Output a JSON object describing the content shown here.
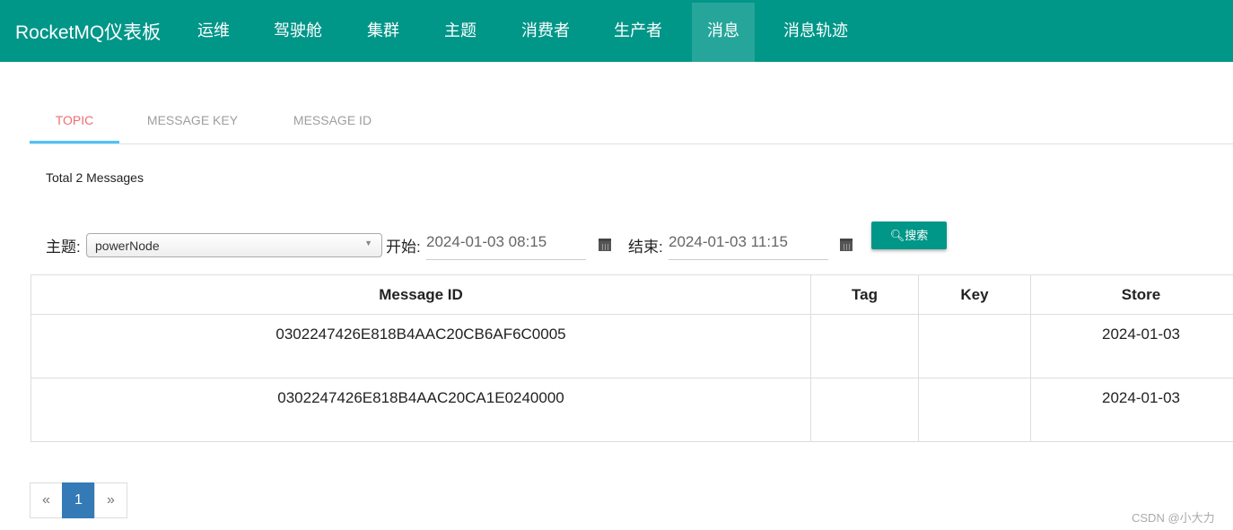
{
  "nav": {
    "brand": "RocketMQ仪表板",
    "items": [
      "运维",
      "驾驶舱",
      "集群",
      "主题",
      "消费者",
      "生产者",
      "消息",
      "消息轨迹"
    ],
    "active": "消息"
  },
  "tabs": [
    "TOPIC",
    "MESSAGE KEY",
    "MESSAGE ID"
  ],
  "total": "Total 2 Messages",
  "form": {
    "topic_label": "主题:",
    "topic_value": "powerNode",
    "start_label": "开始:",
    "start_value": "2024-01-03 08:15",
    "end_label": "结束:",
    "end_value": "2024-01-03 11:15",
    "search_label": "搜索"
  },
  "table": {
    "headers": [
      "Message ID",
      "Tag",
      "Key",
      "Store"
    ],
    "rows": [
      [
        "0302247426E818B4AAC20CB6AF6C0005",
        "",
        "",
        "2024-01-03"
      ],
      [
        "0302247426E818B4AAC20CA1E0240000",
        "",
        "",
        "2024-01-03"
      ]
    ]
  },
  "pager": {
    "prev": "«",
    "page": "1",
    "next": "»"
  },
  "watermark": "CSDN @小大力",
  "colors": {
    "nav": "#009688",
    "accent": "#ee6e73",
    "tab_indicator": "#4fc3f7",
    "page_active": "#337ab7"
  }
}
